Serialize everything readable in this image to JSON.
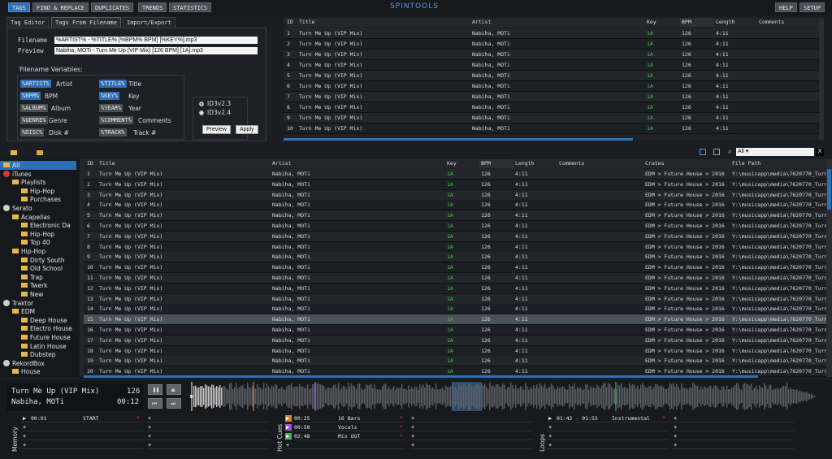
{
  "nav": {
    "tags": "TAGS",
    "find_replace": "FIND & REPLACE",
    "duplicates": "DUPLICATES",
    "trends": "TRENDS",
    "statistics": "STATISTICS",
    "title": "SPINTOOLS",
    "help": "HELP",
    "setup": "SETUP"
  },
  "tag_editor": {
    "tabs": [
      "Tag Editor",
      "Tags From Filename",
      "Import/Export"
    ],
    "filename_label": "Filename",
    "filename_value": "%ARTIST% - %TITLE% [%BPM% BPM] [%KEY%].mp3",
    "preview_label": "Preview",
    "preview_value": "Nabiha, MOTi - Turn Me Up (VIP Mix) [126 BPM] [1A].mp3",
    "vars_title": "Filename Variables:",
    "vars": [
      {
        "tag": "%ARTIST%",
        "label": "Artist"
      },
      {
        "tag": "%TITLE%",
        "label": "Title"
      },
      {
        "tag": "%BPM%",
        "label": "BPM"
      },
      {
        "tag": "%KEY%",
        "label": "Key"
      },
      {
        "tag": "%ALBUM%",
        "label": "Album"
      },
      {
        "tag": "%YEAR%",
        "label": "Year"
      },
      {
        "tag": "%GENRE%",
        "label": "Genre"
      },
      {
        "tag": "%COMMENT%",
        "label": "Comments"
      },
      {
        "tag": "%DISC%",
        "label": "Disk #"
      },
      {
        "tag": "%TRACK%",
        "label": "Track #"
      }
    ],
    "id3": [
      "ID3v2.3",
      "ID3v2.4"
    ],
    "preview_btn": "Preview",
    "apply_btn": "Apply"
  },
  "top_table": {
    "headers": [
      "ID",
      "Title",
      "Artist",
      "Key",
      "BPM",
      "Length",
      "Comments"
    ],
    "title": "Turn Me Up (VIP Mix)",
    "artist": "Nabiha, MOTi",
    "key": "1A",
    "bpm": "126",
    "length": "4:11",
    "ids": [
      "1",
      "2",
      "3",
      "4",
      "5",
      "6",
      "7",
      "8",
      "9",
      "10"
    ]
  },
  "library_toolbar": {
    "filter": "All ▾",
    "clear": "X"
  },
  "sidebar": [
    {
      "label": "All",
      "indent": 0,
      "icon": "folder"
    },
    {
      "label": "iTunes",
      "indent": 0,
      "icon": "itunes"
    },
    {
      "label": "Playlists",
      "indent": 1,
      "icon": "folder"
    },
    {
      "label": "Hip-Hop",
      "indent": 2,
      "icon": "folder"
    },
    {
      "label": "Purchases",
      "indent": 2,
      "icon": "folder"
    },
    {
      "label": "Serato",
      "indent": 0,
      "icon": "serato"
    },
    {
      "label": "Acapellas",
      "indent": 1,
      "icon": "folder"
    },
    {
      "label": "Electronic Da",
      "indent": 2,
      "icon": "folder"
    },
    {
      "label": "Hip-Hop",
      "indent": 2,
      "icon": "folder"
    },
    {
      "label": "Top 40",
      "indent": 2,
      "icon": "folder"
    },
    {
      "label": "Hip-Hop",
      "indent": 1,
      "icon": "folder"
    },
    {
      "label": "Dirty South",
      "indent": 2,
      "icon": "folder"
    },
    {
      "label": "Old School",
      "indent": 2,
      "icon": "folder"
    },
    {
      "label": "Trap",
      "indent": 2,
      "icon": "folder"
    },
    {
      "label": "Twerk",
      "indent": 2,
      "icon": "folder"
    },
    {
      "label": "New",
      "indent": 2,
      "icon": "folder"
    },
    {
      "label": "Traktor",
      "indent": 0,
      "icon": "traktor"
    },
    {
      "label": "EDM",
      "indent": 1,
      "icon": "folder"
    },
    {
      "label": "Deep House",
      "indent": 2,
      "icon": "folder"
    },
    {
      "label": "Electro House",
      "indent": 2,
      "icon": "folder"
    },
    {
      "label": "Future House",
      "indent": 2,
      "icon": "folder"
    },
    {
      "label": "Latin House",
      "indent": 2,
      "icon": "folder"
    },
    {
      "label": "Dubstep",
      "indent": 2,
      "icon": "folder"
    },
    {
      "label": "RekordBox",
      "indent": 0,
      "icon": "rekordbox"
    },
    {
      "label": "House",
      "indent": 1,
      "icon": "folder"
    }
  ],
  "library": {
    "headers": [
      "ID",
      "Title",
      "Artist",
      "Key",
      "BPM",
      "Length",
      "Comments",
      "Crates",
      "File Path"
    ],
    "title": "Turn Me Up (VIP Mix)",
    "artist": "Nabiha, MOTi",
    "key": "1A",
    "bpm": "126",
    "length": "4:11",
    "crate": "EDM > Future House > 2016",
    "path": "Y:\\musicapp\\media\\7620770_Turn_",
    "ids": [
      "1",
      "2",
      "3",
      "4",
      "5",
      "6",
      "7",
      "8",
      "9",
      "10",
      "11",
      "12",
      "13",
      "14",
      "15",
      "16",
      "17",
      "18",
      "19",
      "20"
    ],
    "selected_id": "15"
  },
  "player": {
    "title": "Turn Me Up (VIP Mix)",
    "bpm": "126",
    "artist": "Nabiha, MOTi",
    "time": "00:12"
  },
  "memory": {
    "label": "Memory",
    "time": "00:01",
    "name": "START"
  },
  "hotcues": {
    "label": "Hot Cues",
    "items": [
      {
        "time": "00:25",
        "name": "16 Bars",
        "color": "#e07b2a"
      },
      {
        "time": "00:50",
        "name": "Vocals",
        "color": "#9b4fd6"
      },
      {
        "time": "02:48",
        "name": "Mix OUT",
        "color": "#3fb34f"
      }
    ]
  },
  "loops": {
    "label": "Loops",
    "range": "01:42 - 01:55",
    "name": "Instrumental"
  }
}
